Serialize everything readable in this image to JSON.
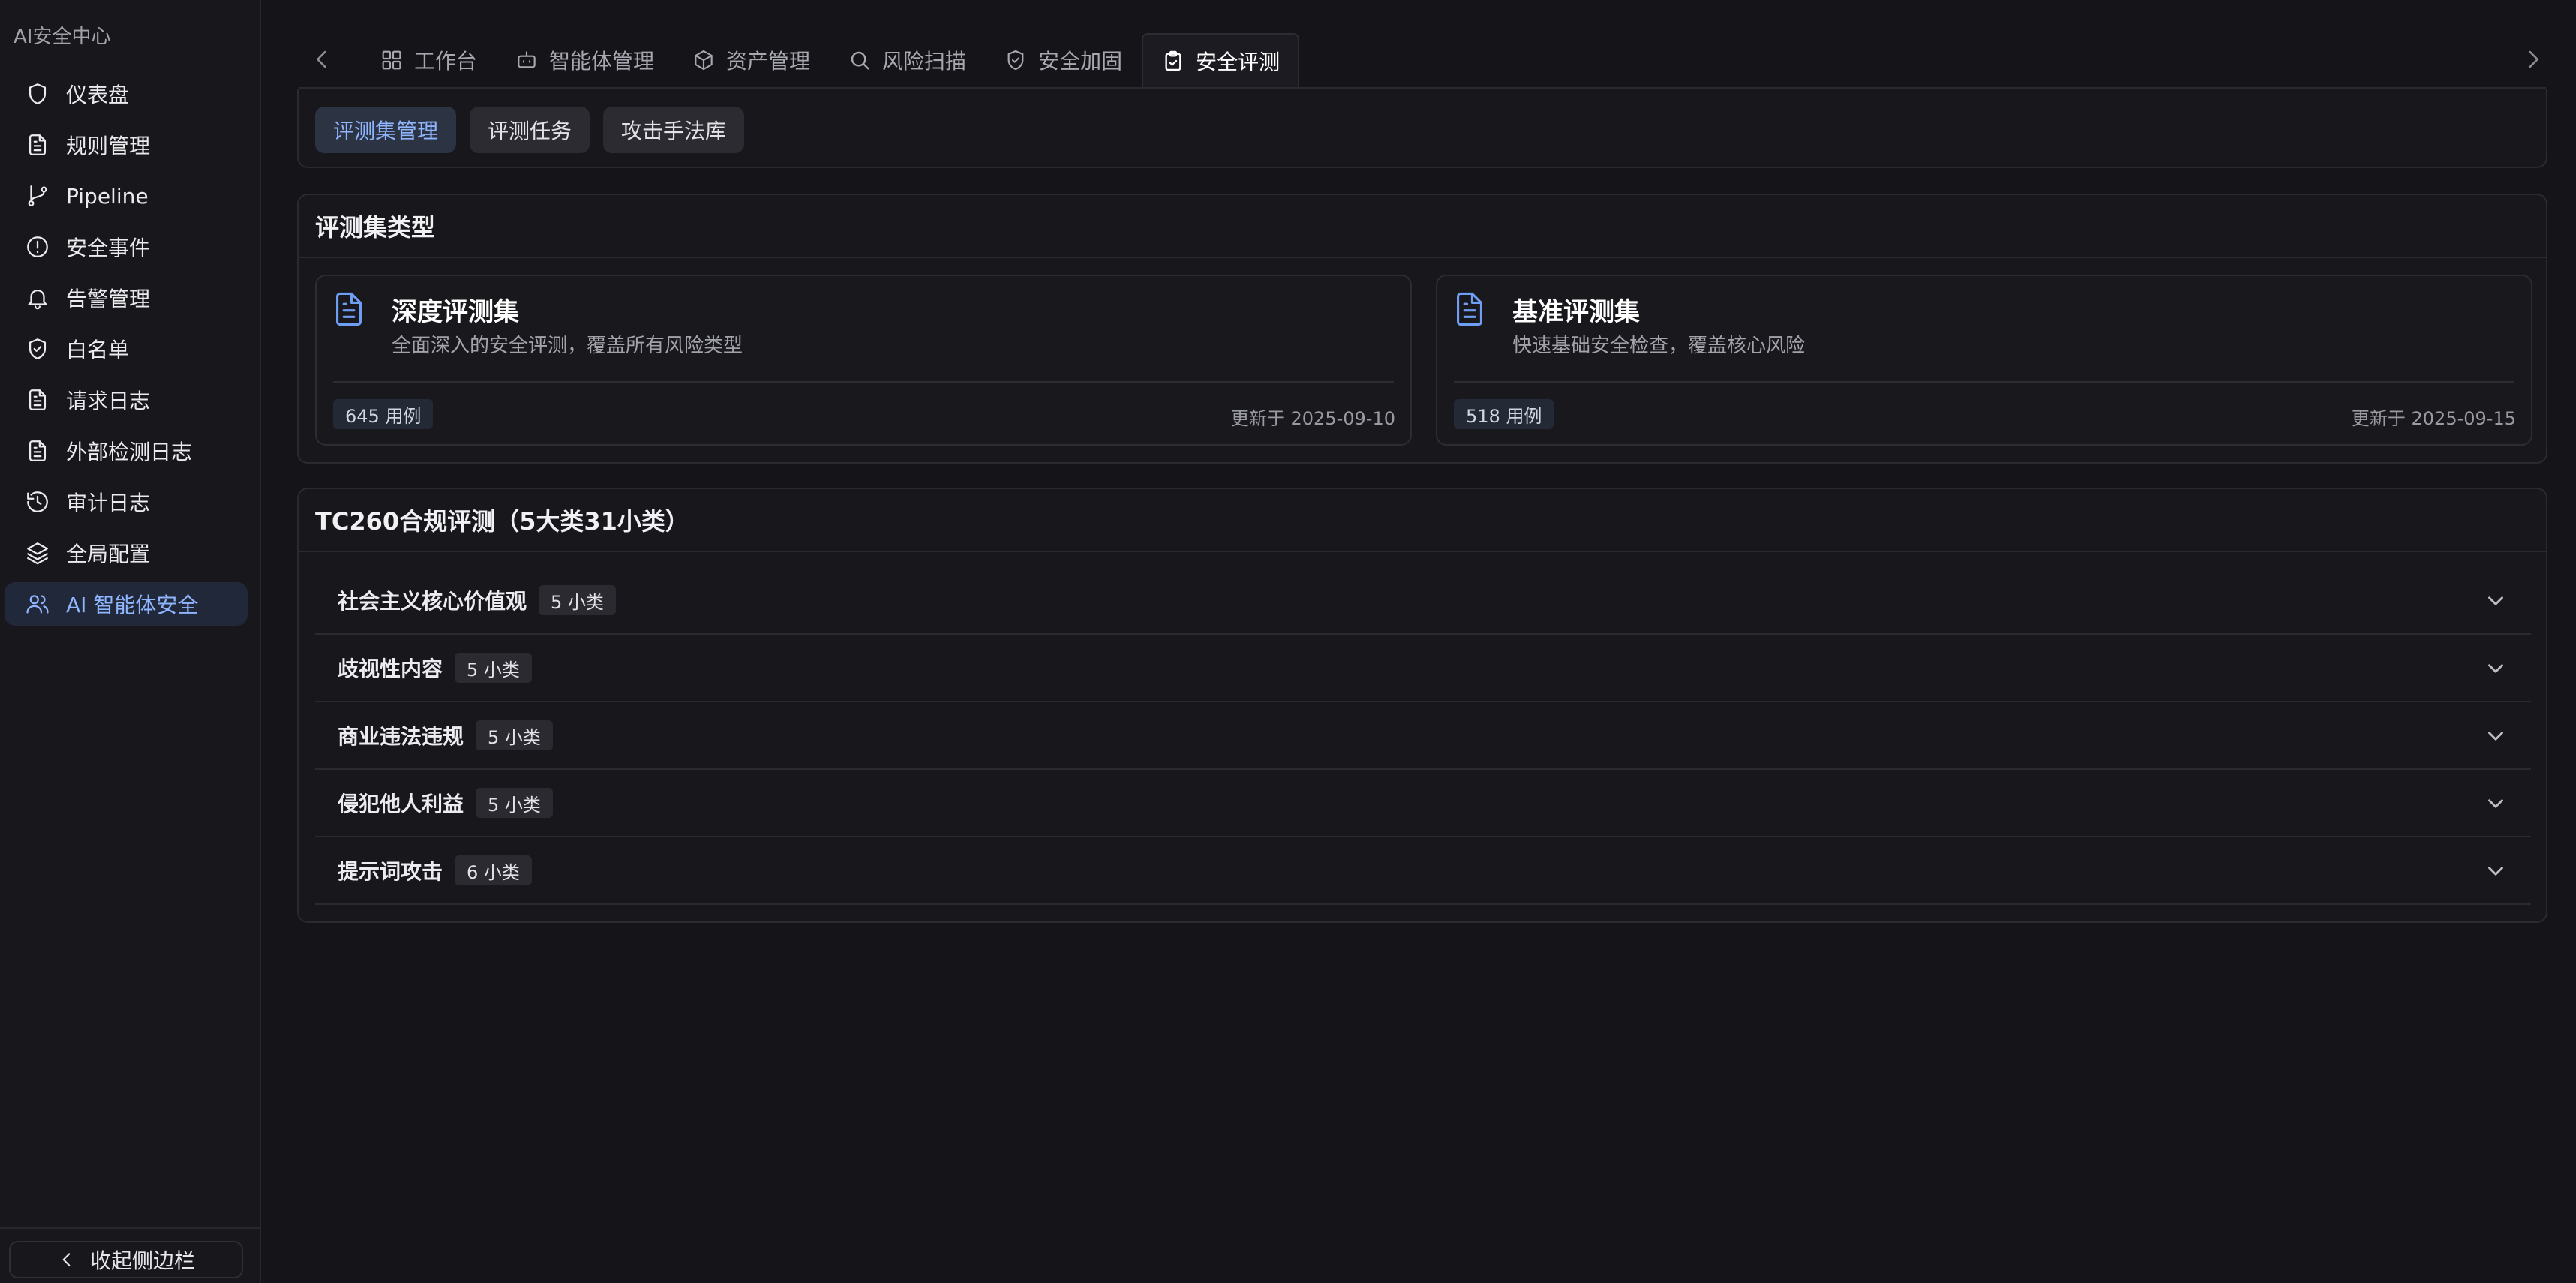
{
  "sidebar": {
    "brand": "AI安全中心",
    "items": [
      {
        "label": "仪表盘",
        "icon": "shield-icon"
      },
      {
        "label": "规则管理",
        "icon": "document-icon"
      },
      {
        "label": "Pipeline",
        "icon": "git-branch-icon"
      },
      {
        "label": "安全事件",
        "icon": "alert-circle-icon"
      },
      {
        "label": "告警管理",
        "icon": "bell-icon"
      },
      {
        "label": "白名单",
        "icon": "shield-check-icon"
      },
      {
        "label": "请求日志",
        "icon": "document-icon"
      },
      {
        "label": "外部检测日志",
        "icon": "document-icon"
      },
      {
        "label": "审计日志",
        "icon": "history-icon"
      },
      {
        "label": "全局配置",
        "icon": "layers-icon"
      },
      {
        "label": "AI 智能体安全",
        "icon": "users-icon",
        "active": true
      }
    ],
    "collapse_label": "收起侧边栏"
  },
  "tabs": [
    {
      "label": "工作台",
      "icon": "grid-icon"
    },
    {
      "label": "智能体管理",
      "icon": "bot-icon"
    },
    {
      "label": "资产管理",
      "icon": "box-icon"
    },
    {
      "label": "风险扫描",
      "icon": "search-icon"
    },
    {
      "label": "安全加固",
      "icon": "shield-check-icon"
    },
    {
      "label": "安全评测",
      "icon": "clipboard-check-icon",
      "active": true
    }
  ],
  "subtabs": [
    {
      "label": "评测集管理",
      "active": true
    },
    {
      "label": "评测任务"
    },
    {
      "label": "攻击手法库"
    }
  ],
  "eval_types": {
    "heading": "评测集类型",
    "cards": [
      {
        "title": "深度评测集",
        "desc": "全面深入的安全评测，覆盖所有风险类型",
        "count": "645 用例",
        "updated": "更新于 2025-09-10"
      },
      {
        "title": "基准评测集",
        "desc": "快速基础安全检查，覆盖核心风险",
        "count": "518 用例",
        "updated": "更新于 2025-09-15"
      }
    ]
  },
  "tc260": {
    "heading": "TC260合规评测（5大类31小类）",
    "rows": [
      {
        "label": "社会主义核心价值观",
        "badge": "5 小类"
      },
      {
        "label": "歧视性内容",
        "badge": "5 小类"
      },
      {
        "label": "商业违法违规",
        "badge": "5 小类"
      },
      {
        "label": "侵犯他人利益",
        "badge": "5 小类"
      },
      {
        "label": "提示词攻击",
        "badge": "6 小类"
      }
    ]
  },
  "colors": {
    "accent": "#8fb6ff",
    "background": "#141419",
    "sidebar": "#18181c"
  }
}
